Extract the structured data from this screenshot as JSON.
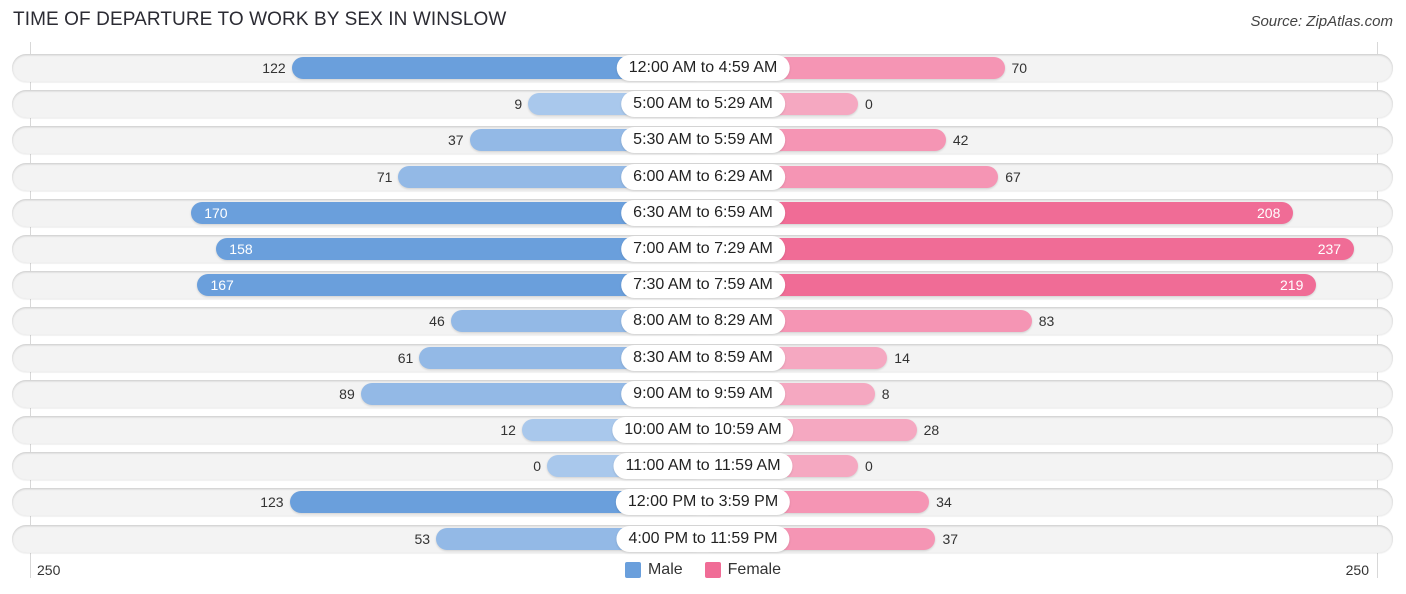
{
  "header": {
    "title": "TIME OF DEPARTURE TO WORK BY SEX IN WINSLOW",
    "source": "Source: ZipAtlas.com"
  },
  "colors": {
    "male_strong": "#6a9fdc",
    "male_light": "#a9c8ec",
    "female_strong": "#f06c96",
    "female_light": "#f5a8c1"
  },
  "chart_data": {
    "type": "bar",
    "orientation": "horizontal-diverging",
    "title": "TIME OF DEPARTURE TO WORK BY SEX IN WINSLOW",
    "categories": [
      "12:00 AM to 4:59 AM",
      "5:00 AM to 5:29 AM",
      "5:30 AM to 5:59 AM",
      "6:00 AM to 6:29 AM",
      "6:30 AM to 6:59 AM",
      "7:00 AM to 7:29 AM",
      "7:30 AM to 7:59 AM",
      "8:00 AM to 8:29 AM",
      "8:30 AM to 8:59 AM",
      "9:00 AM to 9:59 AM",
      "10:00 AM to 10:59 AM",
      "11:00 AM to 11:59 AM",
      "12:00 PM to 3:59 PM",
      "4:00 PM to 11:59 PM"
    ],
    "series": [
      {
        "name": "Male",
        "values": [
          122,
          9,
          37,
          71,
          170,
          158,
          167,
          46,
          61,
          89,
          12,
          0,
          123,
          53
        ]
      },
      {
        "name": "Female",
        "values": [
          70,
          0,
          42,
          67,
          208,
          237,
          219,
          83,
          14,
          8,
          28,
          0,
          34,
          37
        ]
      }
    ],
    "axis": {
      "min_label": "250",
      "max_label": "250",
      "range": [
        0,
        250
      ]
    },
    "legend": {
      "position": "bottom-center",
      "entries": [
        "Male",
        "Female"
      ]
    },
    "grid": false
  }
}
